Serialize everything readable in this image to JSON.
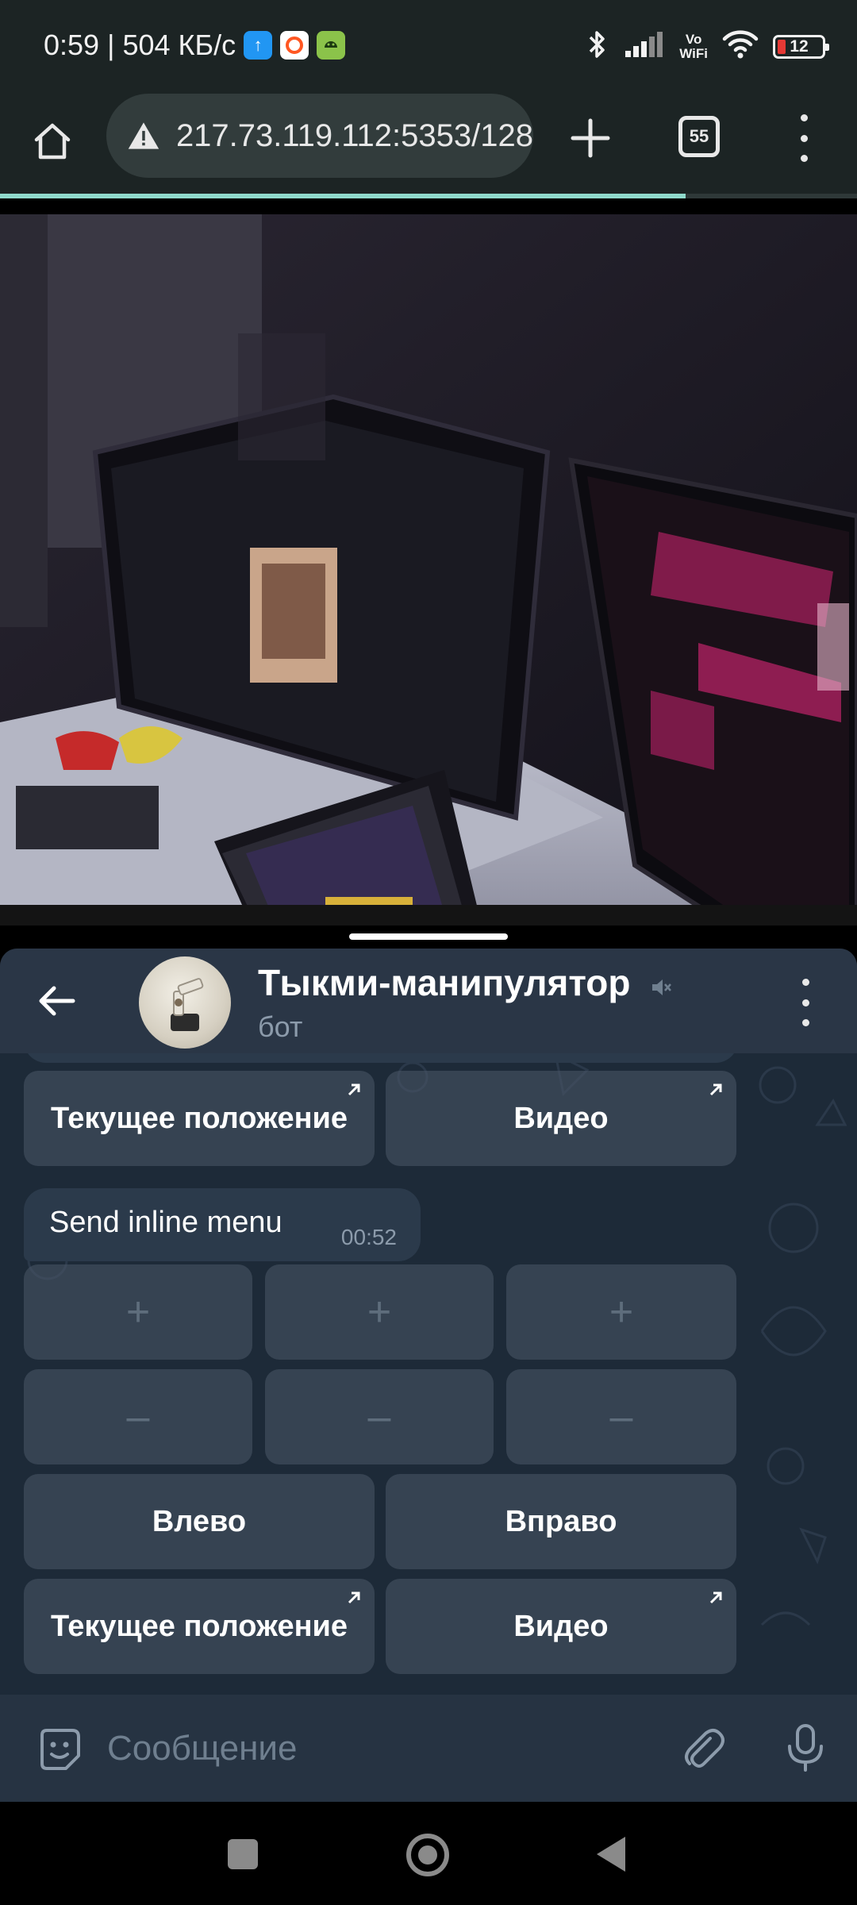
{
  "status_bar": {
    "time": "0:59",
    "network_speed": "504 КБ/с",
    "volte": "Vo",
    "volte_sub": "WiFi",
    "battery_level": "12",
    "icons": [
      "upload-icon",
      "app-icon",
      "android-icon",
      "bluetooth-icon",
      "signal-icon",
      "wifi-icon",
      "battery-icon"
    ]
  },
  "browser": {
    "url": "217.73.119.112:5353/128",
    "tab_count": "55",
    "load_progress": 0.8
  },
  "telegram": {
    "chat_title": "Тыкми-манипулятор",
    "chat_subtitle": "бот",
    "muted": true,
    "top_keyboard": {
      "current_position": "Текущее положение",
      "video": "Видео"
    },
    "message": {
      "text": "Send inline menu",
      "time": "00:52"
    },
    "keyboard": {
      "plus": "+",
      "minus": "–",
      "left": "Влево",
      "right": "Вправо",
      "current_position": "Текущее положение",
      "video": "Видео"
    },
    "input_placeholder": "Сообщение"
  },
  "colors": {
    "chat_background": "#1d2a38",
    "header": "#2a3646",
    "bubble": "#2b3a4b",
    "progress": "#8fd9cb",
    "battery_low": "#e53935"
  }
}
